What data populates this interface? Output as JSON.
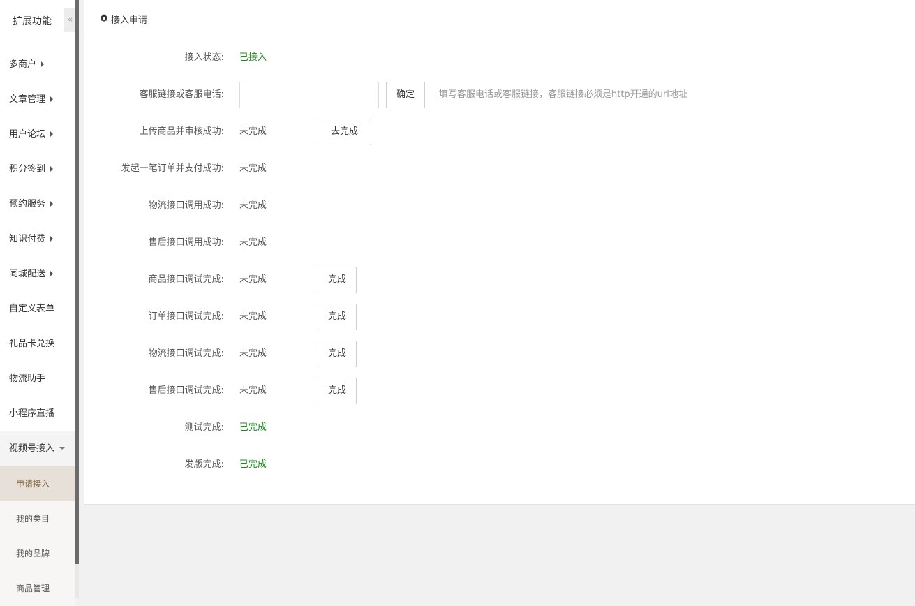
{
  "sidebar": {
    "title": "扩展功能",
    "collapse_glyph": "«",
    "items": [
      {
        "label": "多商户",
        "has_children": true
      },
      {
        "label": "文章管理",
        "has_children": true
      },
      {
        "label": "用户论坛",
        "has_children": true
      },
      {
        "label": "积分签到",
        "has_children": true
      },
      {
        "label": "预约服务",
        "has_children": true
      },
      {
        "label": "知识付费",
        "has_children": true
      },
      {
        "label": "同城配送",
        "has_children": true
      },
      {
        "label": "自定义表单",
        "has_children": false
      },
      {
        "label": "礼品卡兑换",
        "has_children": false
      },
      {
        "label": "物流助手",
        "has_children": false
      },
      {
        "label": "小程序直播",
        "has_children": false
      },
      {
        "label": "视频号接入",
        "has_children": true,
        "open": true
      }
    ],
    "sub_items": [
      {
        "label": "申请接入",
        "active": true
      },
      {
        "label": "我的类目",
        "active": false
      },
      {
        "label": "我的品牌",
        "active": false
      },
      {
        "label": "商品管理",
        "active": false
      }
    ]
  },
  "panel": {
    "title": "接入申请",
    "title_icon": "gear-icon",
    "rows": {
      "access_status": {
        "label": "接入状态:",
        "value": "已接入"
      },
      "service": {
        "label": "客服链接或客服电话:",
        "input_value": "",
        "button": "确定",
        "hint": "填写客服电话或客服链接，客服链接必须是http开通的url地址"
      },
      "upload": {
        "label": "上传商品并审核成功:",
        "value": "未完成",
        "button": "去完成"
      },
      "order": {
        "label": "发起一笔订单并支付成功:",
        "value": "未完成"
      },
      "logistics_call": {
        "label": "物流接口调用成功:",
        "value": "未完成"
      },
      "aftersale_call": {
        "label": "售后接口调用成功:",
        "value": "未完成"
      },
      "product_debug": {
        "label": "商品接口调试完成:",
        "value": "未完成",
        "button": "完成"
      },
      "order_debug": {
        "label": "订单接口调试完成:",
        "value": "未完成",
        "button": "完成"
      },
      "logistics_debug": {
        "label": "物流接口调试完成:",
        "value": "未完成",
        "button": "完成"
      },
      "aftersale_debug": {
        "label": "售后接口调试完成:",
        "value": "未完成",
        "button": "完成"
      },
      "test_done": {
        "label": "测试完成:",
        "value": "已完成"
      },
      "release_done": {
        "label": "发版完成:",
        "value": "已完成"
      }
    }
  },
  "colors": {
    "success": "#1a8a1a",
    "active_sub_bg": "#e6e0d8",
    "active_sub_text": "#8a6a43"
  }
}
